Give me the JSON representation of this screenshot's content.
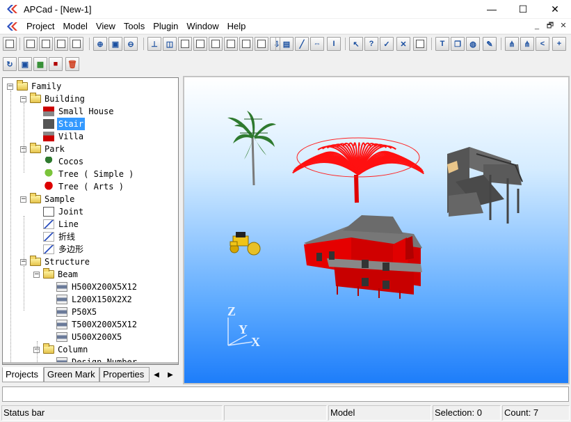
{
  "window": {
    "title": "APCad - [New-1]",
    "minimize_glyph": "—",
    "maximize_glyph": "☐",
    "close_glyph": "✕"
  },
  "menu": {
    "items": [
      "Project",
      "Model",
      "View",
      "Tools",
      "Plugin",
      "Window",
      "Help"
    ],
    "mdi_minimize": "_",
    "mdi_restore": "🗗",
    "mdi_close": "✕"
  },
  "toolbar1": [
    {
      "icon": "new-page-icon"
    },
    {
      "icon": "add-page-icon"
    },
    {
      "icon": "grid-icon"
    },
    {
      "icon": "window-icon"
    },
    {
      "icon": "list-icon"
    },
    {
      "icon": "zoom-in-icon"
    },
    {
      "icon": "save-icon"
    },
    {
      "icon": "zoom-out-icon"
    },
    {
      "icon": "axis-icon"
    },
    {
      "icon": "view-3d-icon"
    },
    {
      "icon": "view-front-icon"
    },
    {
      "icon": "view-top-icon"
    },
    {
      "icon": "view-right-icon"
    },
    {
      "icon": "view-left-icon"
    },
    {
      "icon": "view-bottom-icon"
    },
    {
      "icon": "view-back-icon"
    },
    {
      "icon": "export-icon"
    },
    {
      "icon": "print-icon"
    },
    {
      "icon": "line-icon"
    },
    {
      "icon": "dimension-icon"
    },
    {
      "icon": "ibeam-icon"
    },
    {
      "icon": "select-icon"
    },
    {
      "icon": "help-cursor-icon"
    },
    {
      "icon": "check-icon"
    },
    {
      "icon": "delete-icon"
    },
    {
      "icon": "edit-icon"
    },
    {
      "icon": "text-icon"
    },
    {
      "icon": "copy-icon"
    },
    {
      "icon": "globe-icon"
    },
    {
      "icon": "palette-icon"
    },
    {
      "icon": "tree-icon"
    },
    {
      "icon": "hierarchy-icon"
    },
    {
      "icon": "share-icon"
    },
    {
      "icon": "add-node-icon"
    }
  ],
  "toolbar2": [
    {
      "icon": "refresh-icon"
    },
    {
      "icon": "save-as-icon"
    },
    {
      "icon": "image-icon"
    },
    {
      "icon": "lock-icon"
    },
    {
      "icon": "trash-icon"
    }
  ],
  "tree": {
    "nodes": [
      {
        "label": "Family",
        "level": 0,
        "kind": "folder",
        "expander": "−"
      },
      {
        "label": "Building",
        "level": 1,
        "kind": "folder",
        "expander": "−"
      },
      {
        "label": "Small House",
        "level": 2,
        "kind": "house-icon"
      },
      {
        "label": "Stair",
        "level": 2,
        "kind": "stair-icon",
        "selected": true
      },
      {
        "label": "Villa",
        "level": 2,
        "kind": "villa-icon"
      },
      {
        "label": "Park",
        "level": 1,
        "kind": "folder",
        "expander": "−"
      },
      {
        "label": "Cocos",
        "level": 2,
        "kind": "palm-icon"
      },
      {
        "label": "Tree ( Simple )",
        "level": 2,
        "kind": "tree-icon"
      },
      {
        "label": "Tree ( Arts )",
        "level": 2,
        "kind": "art-tree-icon"
      },
      {
        "label": "Sample",
        "level": 1,
        "kind": "folder",
        "expander": "−"
      },
      {
        "label": "Joint",
        "level": 2,
        "kind": "document-icon"
      },
      {
        "label": "Line",
        "level": 2,
        "kind": "line-icon"
      },
      {
        "label": "折线",
        "level": 2,
        "kind": "line-icon"
      },
      {
        "label": "多边形",
        "level": 2,
        "kind": "line-icon"
      },
      {
        "label": "Structure",
        "level": 1,
        "kind": "folder",
        "expander": "−"
      },
      {
        "label": "Beam",
        "level": 2,
        "kind": "folder",
        "expander": "−"
      },
      {
        "label": "H500X200X5X12",
        "level": 3,
        "kind": "beam-icon"
      },
      {
        "label": "L200X150X2X2",
        "level": 3,
        "kind": "beam-icon"
      },
      {
        "label": "P50X5",
        "level": 3,
        "kind": "beam-icon"
      },
      {
        "label": "T500X200X5X12",
        "level": 3,
        "kind": "beam-icon"
      },
      {
        "label": "U500X200X5",
        "level": 3,
        "kind": "beam-icon"
      },
      {
        "label": "Column",
        "level": 2,
        "kind": "folder",
        "expander": "−"
      },
      {
        "label": "Design Number",
        "level": 3,
        "kind": "beam-icon"
      }
    ]
  },
  "tabs": {
    "items": [
      "Projects",
      "Green Mark",
      "Properties"
    ],
    "active": "Projects",
    "prev_glyph": "◀",
    "next_glyph": "▶"
  },
  "viewport": {
    "axis_labels": {
      "z": "Z",
      "y": "Y",
      "x": "X"
    },
    "objects": [
      "palm-tree",
      "red-art-tree",
      "stair",
      "roller",
      "house"
    ]
  },
  "command_line": {
    "value": ""
  },
  "status": {
    "text": "Status bar",
    "mode": "Model",
    "selection": "Selection: 0",
    "count": "Count: 7"
  },
  "colors": {
    "sky_top": "#ffffff",
    "sky_bottom": "#1d7dfa",
    "selection_blue": "#3399ff",
    "model_red": "#ff0000"
  }
}
